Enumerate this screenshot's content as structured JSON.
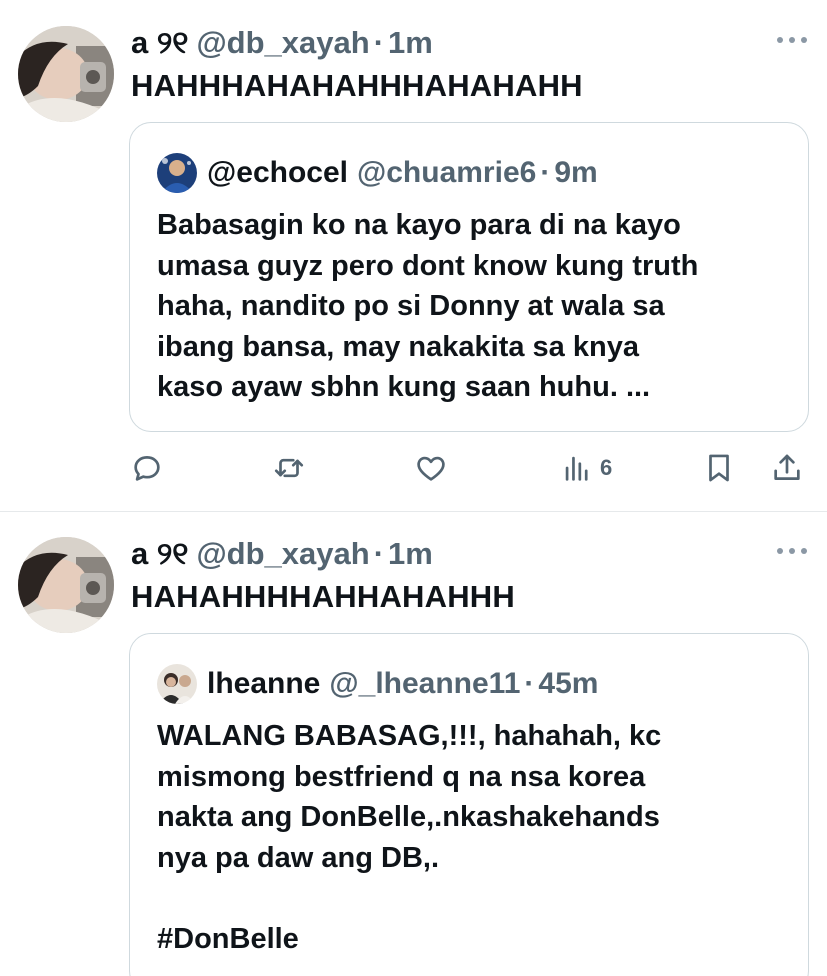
{
  "tweets": [
    {
      "display_name": "a ୨୧",
      "handle": "@db_xayah",
      "separator": "·",
      "time": "1m",
      "text": "HAHHHAHAHAHHHAHAHAHH",
      "quote": {
        "display_name": "@echocel",
        "handle": "@chuamrie6",
        "separator": "·",
        "time": "9m",
        "lines": [
          "Babasagin ko na kayo para di na kayo",
          "umasa guyz pero dont know kung truth",
          "haha, nandito po si Donny at wala sa",
          "ibang bansa, may  nakakita sa  knya",
          "kaso ayaw sbhn kung saan huhu. ..."
        ]
      },
      "actions": {
        "reply_icon": "reply-icon",
        "retweet_icon": "retweet-icon",
        "like_icon": "heart-icon",
        "views_icon": "views-icon",
        "views_count": "6",
        "bookmark_icon": "bookmark-icon",
        "share_icon": "share-icon"
      }
    },
    {
      "display_name": "a ୨୧",
      "handle": "@db_xayah",
      "separator": "·",
      "time": "1m",
      "text": "HAHAHHHHAHHAHAHHH",
      "quote": {
        "display_name": "lheanne",
        "handle": "@_lheanne11",
        "separator": "·",
        "time": "45m",
        "lines": [
          "WALANG BABASAG,!!!,  hahahah, kc",
          "mismong bestfriend q na nsa korea",
          "nakta ang DonBelle,.nkashakehands",
          "nya pa daw ang DB,.",
          "",
          "#DonBelle"
        ]
      }
    }
  ],
  "colors": {
    "text_primary": "#0f1419",
    "text_secondary": "#536471",
    "border": "#cfd9de",
    "divider": "#e6e9eb"
  }
}
